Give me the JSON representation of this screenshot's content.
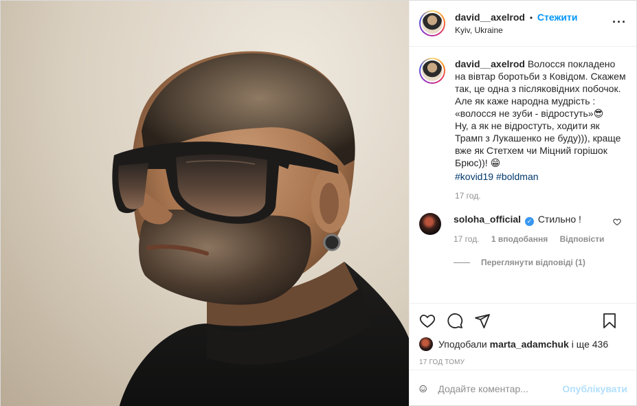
{
  "post": {
    "username": "david__axelrod",
    "follow_label": "Стежити",
    "location": "Kyiv, Ukraine",
    "more_icon": "more-icon"
  },
  "caption": {
    "username": "david__axelrod",
    "text": "Волосся покладено на вівтар боротьби з Ковідом. Скажем так, це одна з післяковідних побочок. Але як каже народна мудрість : «волосся не зуби - відростуть»😎\nНу, а як не відростуть, ходити як Трамп з Лукашенко не буду))), краще вже як Стетхем чи Міцний горішок Брюс))! 😁",
    "hashtags": [
      "#kovid19",
      "#boldman"
    ],
    "time": "17 год."
  },
  "comment": {
    "username": "soloha_official",
    "verified_icon": "verified-icon",
    "text": "Стильно !",
    "time": "17 год.",
    "likes_label": "1 вподобання",
    "reply_label": "Відповісти",
    "view_replies_label": "Переглянути відповіді (1)"
  },
  "actions": {
    "like_icon": "heart-icon",
    "comment_icon": "comment-icon",
    "share_icon": "share-icon",
    "save_icon": "bookmark-icon"
  },
  "likes": {
    "prefix": "Уподобали",
    "user": "marta_adamchuk",
    "suffix": "і ще 436"
  },
  "date": "17 ГОД ТОМУ",
  "add_comment": {
    "placeholder": "Додайте коментар...",
    "publish_label": "Опублікувати"
  },
  "colors": {
    "accent": "#0095f6",
    "publish_disabled": "#b2dffc",
    "muted": "#8e8e8e",
    "text": "#262626"
  }
}
